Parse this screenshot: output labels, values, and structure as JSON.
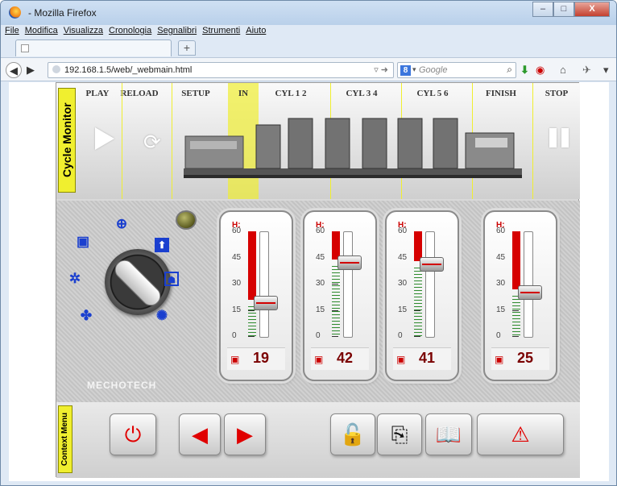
{
  "window": {
    "title": " - Mozilla Firefox",
    "controls": {
      "minimize": "–",
      "maximize": "□",
      "close": "X"
    }
  },
  "menu": [
    "File",
    "Modifica",
    "Visualizza",
    "Cronologia",
    "Segnalibri",
    "Strumenti",
    "Aiuto"
  ],
  "tabs": {
    "new_tab": "+"
  },
  "navbar": {
    "url": "192.168.1.5/web/_webmain.html",
    "search_placeholder": "Google",
    "search_engine_icon": "8"
  },
  "app": {
    "cycle_monitor_label": "Cycle Monitor",
    "context_menu_label": "Context Menu",
    "steps": [
      "PLAY",
      "RELOAD",
      "SETUP",
      "IN",
      "CYL 1 2",
      "CYL 3 4",
      "CYL 5 6",
      "FINISH",
      "STOP"
    ],
    "active_step": "IN",
    "brand": "MECHOTECH",
    "gauges": [
      {
        "h_label": "H:",
        "value": "19",
        "level": 19,
        "scale": [
          "60",
          "45",
          "30",
          "15",
          "0"
        ]
      },
      {
        "h_label": "H:",
        "value": "42",
        "level": 42,
        "scale": [
          "60",
          "45",
          "30",
          "15",
          "0"
        ]
      },
      {
        "h_label": "H:",
        "value": "41",
        "level": 41,
        "scale": [
          "60",
          "45",
          "30",
          "15",
          "0"
        ]
      },
      {
        "h_label": "H:",
        "value": "25",
        "level": 25,
        "scale": [
          "60",
          "45",
          "30",
          "15",
          "0"
        ]
      }
    ],
    "dial_icons": [
      "briefcase-icon",
      "globe-icon",
      "upload-icon",
      "gears-icon",
      "portrait-icon",
      "fan-icon",
      "sun-icon"
    ],
    "context_buttons": [
      "power-icon",
      "arrow-left-icon",
      "arrow-right-icon",
      "unlock-icon",
      "preview-icon",
      "book-icon",
      "warning-icon"
    ],
    "colors": {
      "accent_yellow": "#f0ef2f",
      "alert_red": "#e00000",
      "value_red": "#7a0000",
      "icon_blue": "#1a3fcf"
    }
  }
}
